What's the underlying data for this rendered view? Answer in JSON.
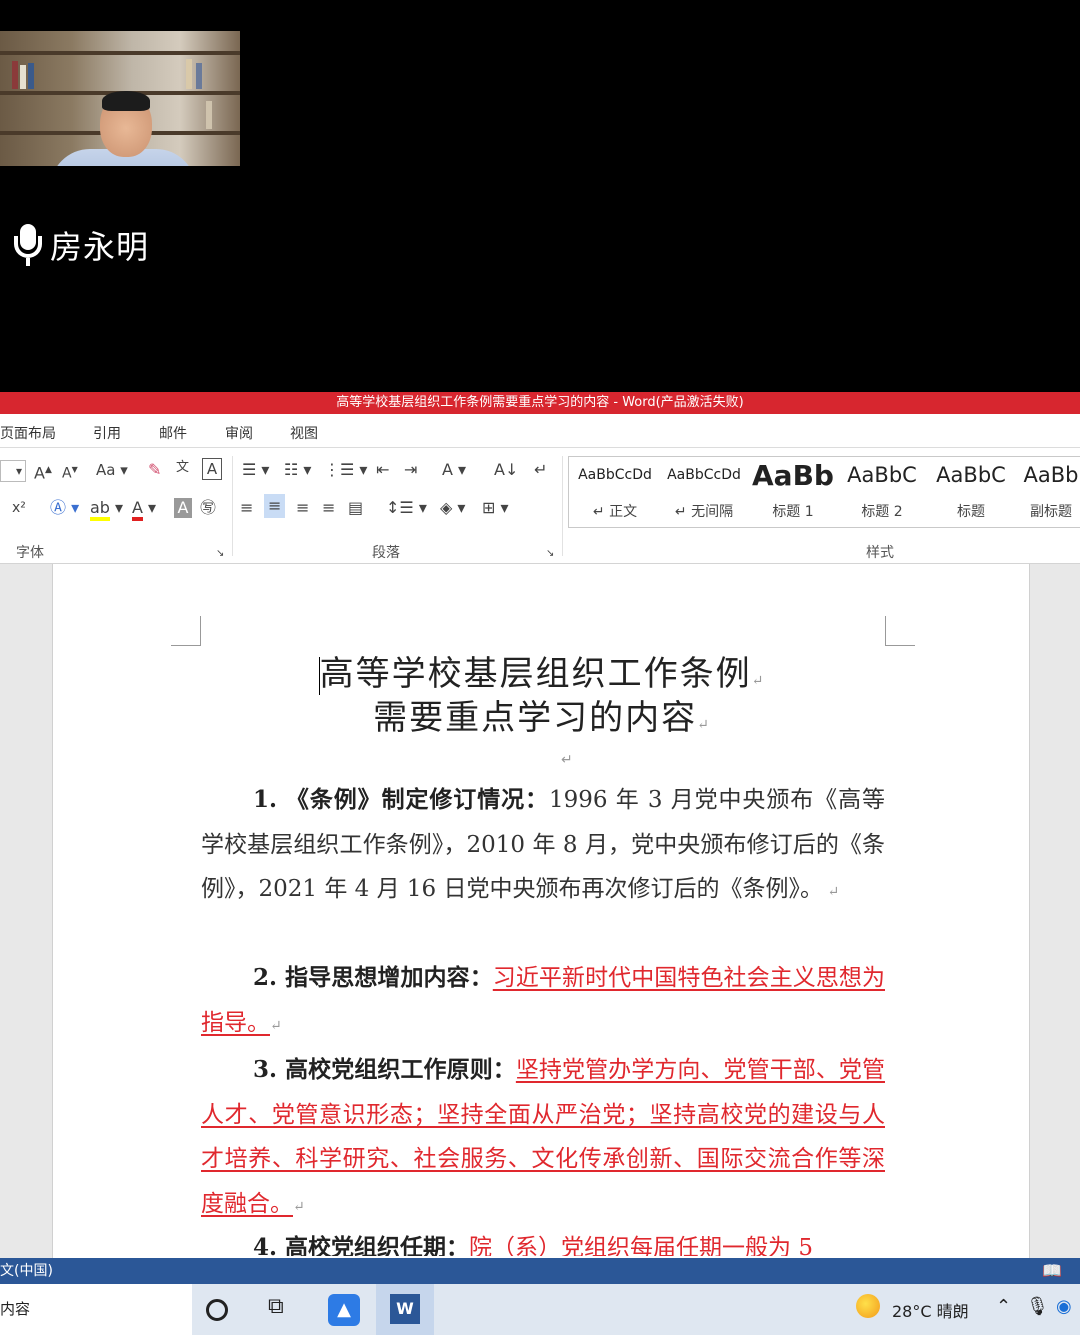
{
  "meeting": {
    "speaker_name": "房永明"
  },
  "word": {
    "window_title": "高等学校基层组织工作条例需要重点学习的内容 - Word(产品激活失败)",
    "menu_tabs": [
      "页面布局",
      "引用",
      "邮件",
      "审阅",
      "视图"
    ],
    "group_labels": {
      "font": "字体",
      "paragraph": "段落",
      "styles": "样式"
    },
    "styles": [
      {
        "sample": "AaBbCcDd",
        "name": "↵ 正文"
      },
      {
        "sample": "AaBbCcDd",
        "name": "↵ 无间隔"
      },
      {
        "sample": "AaBb",
        "name": "标题 1"
      },
      {
        "sample": "AaBbC",
        "name": "标题 2"
      },
      {
        "sample": "AaBbC",
        "name": "标题"
      },
      {
        "sample": "AaBb",
        "name": "副标题"
      }
    ],
    "accent_color": "#d7262f",
    "statusbar_lang": "文(中国)",
    "statusbar_read_icon": "read-mode-icon"
  },
  "document": {
    "title_line1": "高等学校基层组织工作条例",
    "title_line2": "需要重点学习的内容",
    "paragraphs": [
      {
        "heading": "1. 《条例》制定修订情况：",
        "body": "1996 年 3 月党中央颁布《高等学校基层组织工作条例》，2010 年 8 月，党中央颁布修订后的《条例》，2021 年 4 月 16 日党中央颁布再次修订后的《条例》。",
        "highlight": ""
      },
      {
        "heading": "2. 指导思想增加内容：",
        "body": "",
        "highlight": "习近平新时代中国特色社会主义思想为指导。"
      },
      {
        "heading": "3. 高校党组织工作原则：",
        "body": "",
        "highlight": "坚持党管办学方向、党管干部、党管人才、党管意识形态；坚持全面从严治党；坚持高校党的建设与人才培养、科学研究、社会服务、文化传承创新、国际交流合作等深度融合。"
      },
      {
        "heading": "4. 高校党组织任期：",
        "body": "",
        "highlight": "院（系）党组织每届任期一般为 5"
      }
    ],
    "highlight_color": "#e0282e"
  },
  "taskbar": {
    "search_text": "内容",
    "weather": "28°C 晴朗"
  }
}
